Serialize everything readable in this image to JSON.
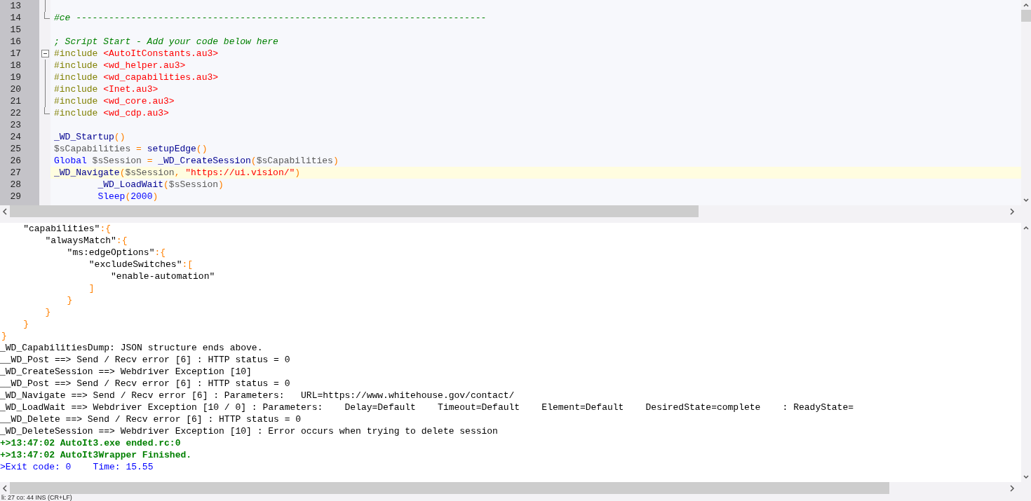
{
  "editor": {
    "lines": [
      {
        "number": "13",
        "kind": "fold-line",
        "current": false
      },
      {
        "number": "14",
        "kind": "fold-end",
        "current": false,
        "tokens": [
          {
            "text": "#ce ---------------------------------------------------------------------------",
            "kind": "comment"
          }
        ]
      },
      {
        "number": "15",
        "current": false
      },
      {
        "number": "16",
        "current": false,
        "tokens": [
          {
            "text": "; Script Start - Add your code below here",
            "kind": "comment"
          }
        ]
      },
      {
        "number": "17",
        "kind": "fold-start",
        "current": false,
        "tokens": [
          {
            "text": "#include",
            "kind": "directive"
          },
          {
            "text": " <AutoItConstants.au3>",
            "kind": "include"
          }
        ]
      },
      {
        "number": "18",
        "kind": "fold-line",
        "current": false,
        "tokens": [
          {
            "text": "#include",
            "kind": "directive"
          },
          {
            "text": " <wd_helper.au3>",
            "kind": "include"
          }
        ]
      },
      {
        "number": "19",
        "kind": "fold-line",
        "current": false,
        "tokens": [
          {
            "text": "#include",
            "kind": "directive"
          },
          {
            "text": " <wd_capabilities.au3>",
            "kind": "include"
          }
        ]
      },
      {
        "number": "20",
        "kind": "fold-line",
        "current": false,
        "tokens": [
          {
            "text": "#include",
            "kind": "directive"
          },
          {
            "text": " <Inet.au3>",
            "kind": "include"
          }
        ]
      },
      {
        "number": "21",
        "kind": "fold-line",
        "current": false,
        "tokens": [
          {
            "text": "#include",
            "kind": "directive"
          },
          {
            "text": " <wd_core.au3>",
            "kind": "include"
          }
        ]
      },
      {
        "number": "22",
        "kind": "fold-end",
        "current": false,
        "tokens": [
          {
            "text": "#include",
            "kind": "directive"
          },
          {
            "text": " <wd_cdp.au3>",
            "kind": "include"
          }
        ]
      },
      {
        "number": "23",
        "current": false
      },
      {
        "number": "24",
        "current": false,
        "tokens": [
          {
            "text": "_WD_Startup",
            "kind": "func"
          },
          {
            "text": "()",
            "kind": "op"
          }
        ]
      },
      {
        "number": "25",
        "current": false,
        "tokens": [
          {
            "text": "$sCapabilities",
            "kind": "var"
          },
          {
            "text": " = ",
            "kind": "op"
          },
          {
            "text": "setupEdge",
            "kind": "func"
          },
          {
            "text": "()",
            "kind": "op"
          }
        ]
      },
      {
        "number": "26",
        "current": false,
        "tokens": [
          {
            "text": "Global",
            "kind": "keyword"
          },
          {
            "text": " $sSession",
            "kind": "var"
          },
          {
            "text": " = ",
            "kind": "op"
          },
          {
            "text": "_WD_CreateSession",
            "kind": "func"
          },
          {
            "text": "(",
            "kind": "op"
          },
          {
            "text": "$sCapabilities",
            "kind": "var"
          },
          {
            "text": ")",
            "kind": "op"
          }
        ]
      },
      {
        "number": "27",
        "current": true,
        "tokens": [
          {
            "text": "_WD_Navigate",
            "kind": "func"
          },
          {
            "text": "(",
            "kind": "op"
          },
          {
            "text": "$sSession",
            "kind": "var"
          },
          {
            "text": ", ",
            "kind": "op"
          },
          {
            "text": "\"https://ui.vision/\"",
            "kind": "string"
          },
          {
            "text": ")",
            "kind": "op"
          }
        ]
      },
      {
        "number": "28",
        "current": false,
        "tokens": [
          {
            "text": "        _WD_LoadWait",
            "kind": "func"
          },
          {
            "text": "(",
            "kind": "op"
          },
          {
            "text": "$sSession",
            "kind": "var"
          },
          {
            "text": ")",
            "kind": "op"
          }
        ]
      },
      {
        "number": "29",
        "current": false,
        "tokens": [
          {
            "text": "        Sleep",
            "kind": "keyword"
          },
          {
            "text": "(",
            "kind": "op"
          },
          {
            "text": "2000",
            "kind": "number"
          },
          {
            "text": ")",
            "kind": "op"
          }
        ]
      }
    ]
  },
  "output": {
    "lines": [
      {
        "kind": "code",
        "tokens": [
          {
            "text": "    \"capabilities\"",
            "kind": "plain"
          },
          {
            "text": ":{",
            "kind": "op"
          }
        ]
      },
      {
        "kind": "code",
        "tokens": [
          {
            "text": "        \"alwaysMatch\"",
            "kind": "plain"
          },
          {
            "text": ":{",
            "kind": "op"
          }
        ]
      },
      {
        "kind": "code",
        "tokens": [
          {
            "text": "            \"ms:edgeOptions\"",
            "kind": "plain"
          },
          {
            "text": ":{",
            "kind": "op"
          }
        ]
      },
      {
        "kind": "code",
        "tokens": [
          {
            "text": "                \"excludeSwitches\"",
            "kind": "plain"
          },
          {
            "text": ":[",
            "kind": "op"
          }
        ]
      },
      {
        "kind": "code",
        "tokens": [
          {
            "text": "                    \"enable-automation\"",
            "kind": "plain"
          }
        ]
      },
      {
        "kind": "code",
        "tokens": [
          {
            "text": "                ]",
            "kind": "op"
          }
        ]
      },
      {
        "kind": "code",
        "tokens": [
          {
            "text": "            }",
            "kind": "op"
          }
        ]
      },
      {
        "kind": "code",
        "tokens": [
          {
            "text": "        }",
            "kind": "op"
          }
        ]
      },
      {
        "kind": "code",
        "tokens": [
          {
            "text": "    }",
            "kind": "op"
          }
        ]
      },
      {
        "kind": "code",
        "tokens": [
          {
            "text": "}",
            "kind": "op"
          }
        ]
      },
      {
        "kind": "normal",
        "text": "_WD_CapabilitiesDump: JSON structure ends above."
      },
      {
        "kind": "normal",
        "text": "__WD_Post ==> Send / Recv error [6] : HTTP status = 0"
      },
      {
        "kind": "normal",
        "text": "_WD_CreateSession ==> Webdriver Exception [10]"
      },
      {
        "kind": "normal",
        "text": "__WD_Post ==> Send / Recv error [6] : HTTP status = 0"
      },
      {
        "kind": "normal",
        "text": "_WD_Navigate ==> Send / Recv error [6] : Parameters:   URL=https://www.whitehouse.gov/contact/"
      },
      {
        "kind": "normal",
        "text": "_WD_LoadWait ==> Webdriver Exception [10 / 0] : Parameters:    Delay=Default    Timeout=Default    Element=Default    DesiredState=complete    : ReadyState="
      },
      {
        "kind": "normal",
        "text": "__WD_Delete ==> Send / Recv error [6] : HTTP status = 0"
      },
      {
        "kind": "normal",
        "text": "_WD_DeleteSession ==> Webdriver Exception [10] : Error occurs when trying to delete session"
      },
      {
        "kind": "success",
        "text": "+>13:47:02 AutoIt3.exe ended.rc:0"
      },
      {
        "kind": "success",
        "text": "+>13:47:02 AutoIt3Wrapper Finished."
      },
      {
        "kind": "info",
        "text": ">Exit code: 0    Time: 15.55"
      }
    ]
  },
  "status_bar": {
    "text": "li: 27 co: 44 INS (CR+LF)"
  }
}
